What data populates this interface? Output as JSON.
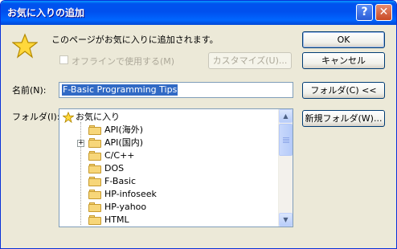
{
  "window": {
    "title": "お気に入りの追加",
    "help_label": "?",
    "close_label": "✕"
  },
  "message": "このページがお気に入りに追加されます。",
  "offline_checkbox": {
    "label": "オフラインで使用する(M)",
    "checked": false
  },
  "customize_button": "カスタマイズ(U)...",
  "ok_button": "OK",
  "cancel_button": "キャンセル",
  "name_label": "名前(N):",
  "name_value": "F-Basic Programming Tips",
  "folder_button": "フォルダ(C) <<",
  "folder_label": "フォルダ(I):",
  "new_folder_button": "新規フォルダ(W)...",
  "tree": {
    "root": "お気に入り",
    "items": [
      {
        "label": "API(海外)",
        "expandable": false
      },
      {
        "label": "API(国内)",
        "expandable": true
      },
      {
        "label": "C/C++",
        "expandable": false
      },
      {
        "label": "DOS",
        "expandable": false
      },
      {
        "label": "F-Basic",
        "expandable": false
      },
      {
        "label": "HP-infoseek",
        "expandable": false
      },
      {
        "label": "HP-yahoo",
        "expandable": false
      },
      {
        "label": "HTML",
        "expandable": false
      }
    ]
  },
  "scroll_up_icon": "triangle-up",
  "scroll_down_icon": "triangle-down",
  "colors": {
    "title_bar": "#0054e3",
    "selection": "#316ac5",
    "dialog_bg": "#ece9d8"
  }
}
